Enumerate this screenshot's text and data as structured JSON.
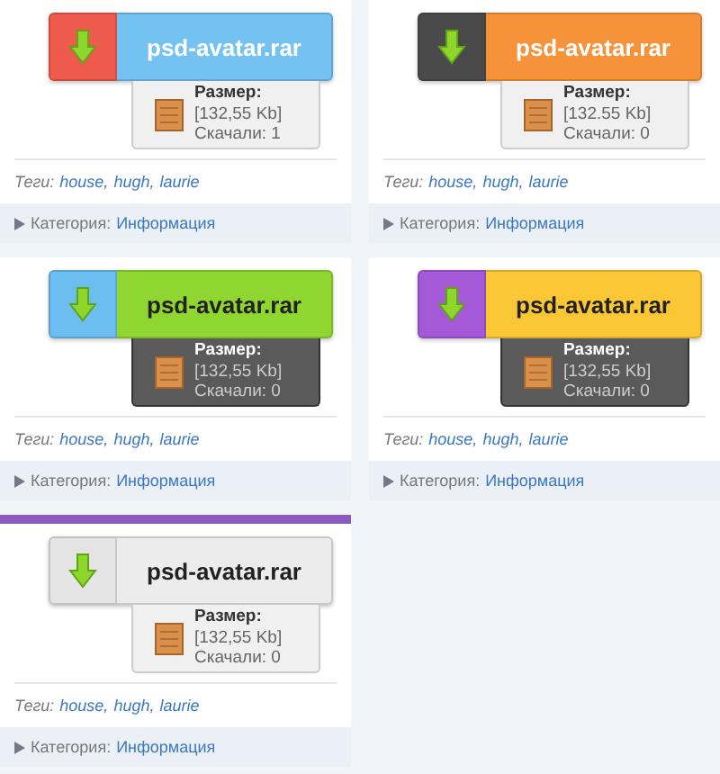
{
  "columns": [
    {
      "cards": [
        {
          "icon_tile": {
            "color": "#ee5a4c"
          },
          "button": {
            "color": "#74c2f2",
            "light_title": true,
            "filename": "psd-avatar.rar"
          },
          "dark_info": false,
          "size_label": "Размер:",
          "size": "[132,55 Kb]",
          "downloads": "Скачали: 1",
          "tags_label": "Теги:",
          "tags": [
            "house,",
            "hugh,",
            "laurie"
          ],
          "category_label": "Категория:",
          "category": "Информация"
        },
        {
          "icon_tile": {
            "color": "#6cbdf0"
          },
          "button": {
            "color": "#8fd630",
            "light_title": false,
            "filename": "psd-avatar.rar"
          },
          "dark_info": true,
          "size_label": "Размер:",
          "size": "[132,55 Kb]",
          "downloads": "Скачали: 0",
          "tags_label": "Теги:",
          "tags": [
            "house,",
            "hugh,",
            "laurie"
          ],
          "category_label": "Категория:",
          "category": "Информация"
        },
        {
          "accent_bar": {
            "color": "#8a5bbf"
          },
          "icon_tile": {
            "color": "#e4e4e4"
          },
          "button": {
            "color": "#ececec",
            "light_title": false,
            "filename": "psd-avatar.rar"
          },
          "dark_info": false,
          "size_label": "Размер:",
          "size": "[132,55 Kb]",
          "downloads": "Скачали: 0",
          "tags_label": "Теги:",
          "tags": [
            "house,",
            "hugh,",
            "laurie"
          ],
          "category_label": "Категория:",
          "category": "Информация"
        }
      ]
    },
    {
      "cards": [
        {
          "icon_tile": {
            "color": "#4a4a4a"
          },
          "button": {
            "color": "#f5923a",
            "light_title": true,
            "filename": "psd-avatar.rar"
          },
          "dark_info": false,
          "size_label": "Размер:",
          "size": "[132.55 Kb]",
          "downloads": "Скачали: 0",
          "tags_label": "Теги:",
          "tags": [
            "house,",
            "hugh,",
            "laurie"
          ],
          "category_label": "Категория:",
          "category": "Информация"
        },
        {
          "icon_tile": {
            "color": "#a45ad8"
          },
          "button": {
            "color": "#fcc734",
            "light_title": false,
            "filename": "psd-avatar.rar"
          },
          "dark_info": true,
          "size_label": "Размер:",
          "size": "[132,55 Kb]",
          "downloads": "Скачали: 0",
          "tags_label": "Теги:",
          "tags": [
            "house,",
            "hugh,",
            "laurie"
          ],
          "category_label": "Категория:",
          "category": "Информация"
        }
      ]
    }
  ]
}
